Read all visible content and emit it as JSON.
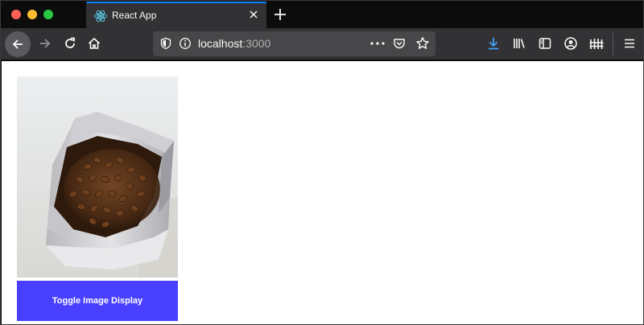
{
  "browser": {
    "tab": {
      "title": "React App"
    },
    "url": {
      "host": "localhost",
      "port": ":3000"
    }
  },
  "page": {
    "toggle_button_label": "Toggle Image Display",
    "image": {
      "subject": "bag of coffee beans"
    }
  },
  "colors": {
    "accent": "#0a84ff",
    "button": "#4940ff",
    "toolbar": "#323234",
    "tabstrip": "#0c0c0d"
  }
}
